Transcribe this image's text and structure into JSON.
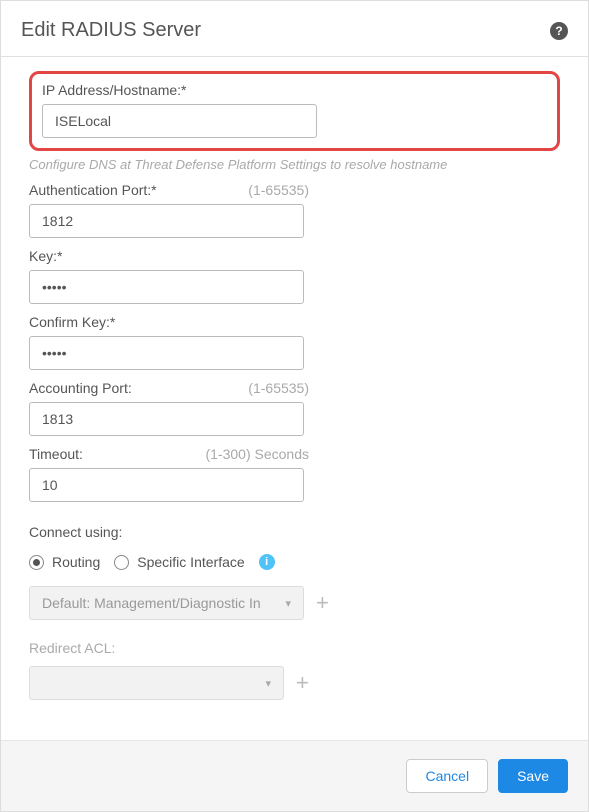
{
  "header": {
    "title": "Edit RADIUS Server"
  },
  "fields": {
    "ip": {
      "label": "IP Address/Hostname:*",
      "value": "ISELocal"
    },
    "dnsNote": "Configure DNS at Threat Defense Platform Settings to resolve hostname",
    "authPort": {
      "label": "Authentication Port:*",
      "hint": "(1-65535)",
      "value": "1812"
    },
    "key": {
      "label": "Key:*",
      "value": "•••••"
    },
    "confirmKey": {
      "label": "Confirm Key:*",
      "value": "•••••"
    },
    "acctPort": {
      "label": "Accounting Port:",
      "hint": "(1-65535)",
      "value": "1813"
    },
    "timeout": {
      "label": "Timeout:",
      "hint": "(1-300) Seconds",
      "value": "10"
    },
    "connect": {
      "label": "Connect using:",
      "routing": "Routing",
      "specific": "Specific Interface"
    },
    "interfaceSelect": "Default: Management/Diagnostic In",
    "redirect": {
      "label": "Redirect ACL:"
    }
  },
  "footer": {
    "cancel": "Cancel",
    "save": "Save"
  }
}
